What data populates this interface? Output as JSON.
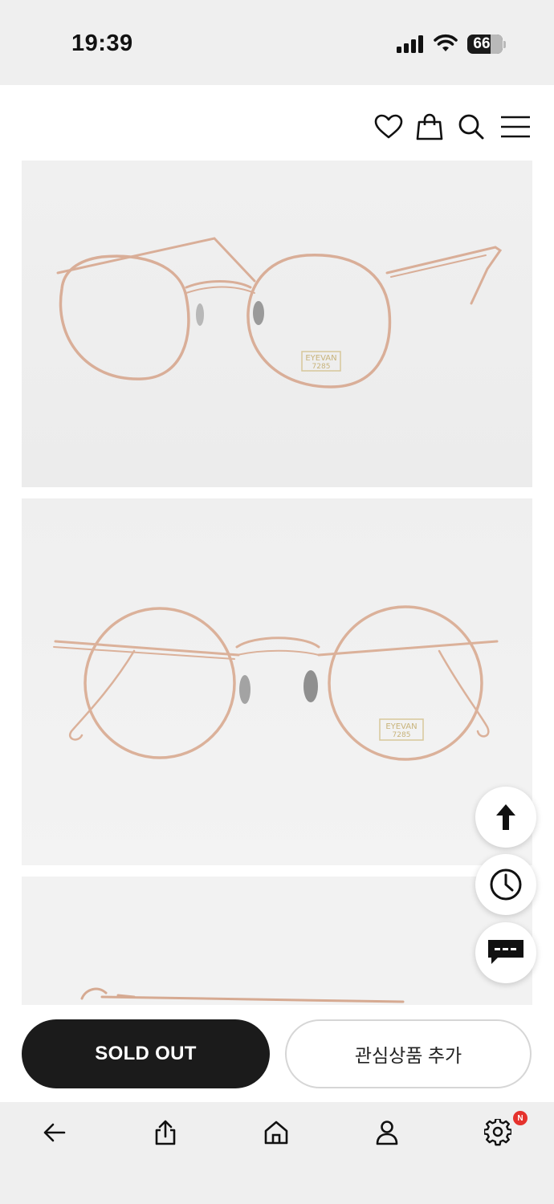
{
  "status_bar": {
    "time": "19:39",
    "battery_percent": "66",
    "icons": [
      "cellular-signal-icon",
      "wifi-icon",
      "battery-icon"
    ]
  },
  "header": {
    "icons": [
      "heart-icon",
      "shopping-bag-icon",
      "search-icon",
      "hamburger-menu-icon"
    ]
  },
  "product_images": [
    {
      "brand_tag": "EYEVAN",
      "brand_sub": "7285"
    },
    {
      "brand_tag": "EYEVAN",
      "brand_sub": "7285"
    }
  ],
  "floating_buttons": [
    "scroll-top-arrow-icon",
    "recently-viewed-clock-icon",
    "chat-bubble-icon"
  ],
  "actions": {
    "soldout_label": "SOLD OUT",
    "wishlist_label": "관심상품 추가"
  },
  "bottom_nav": {
    "items": [
      "back-arrow-icon",
      "share-icon",
      "home-icon",
      "person-icon",
      "settings-gear-icon"
    ],
    "badge": "N"
  },
  "colors": {
    "primary_button": "#1b1b1b",
    "badge": "#e5322d",
    "frame_gold": "#d8ab94"
  }
}
